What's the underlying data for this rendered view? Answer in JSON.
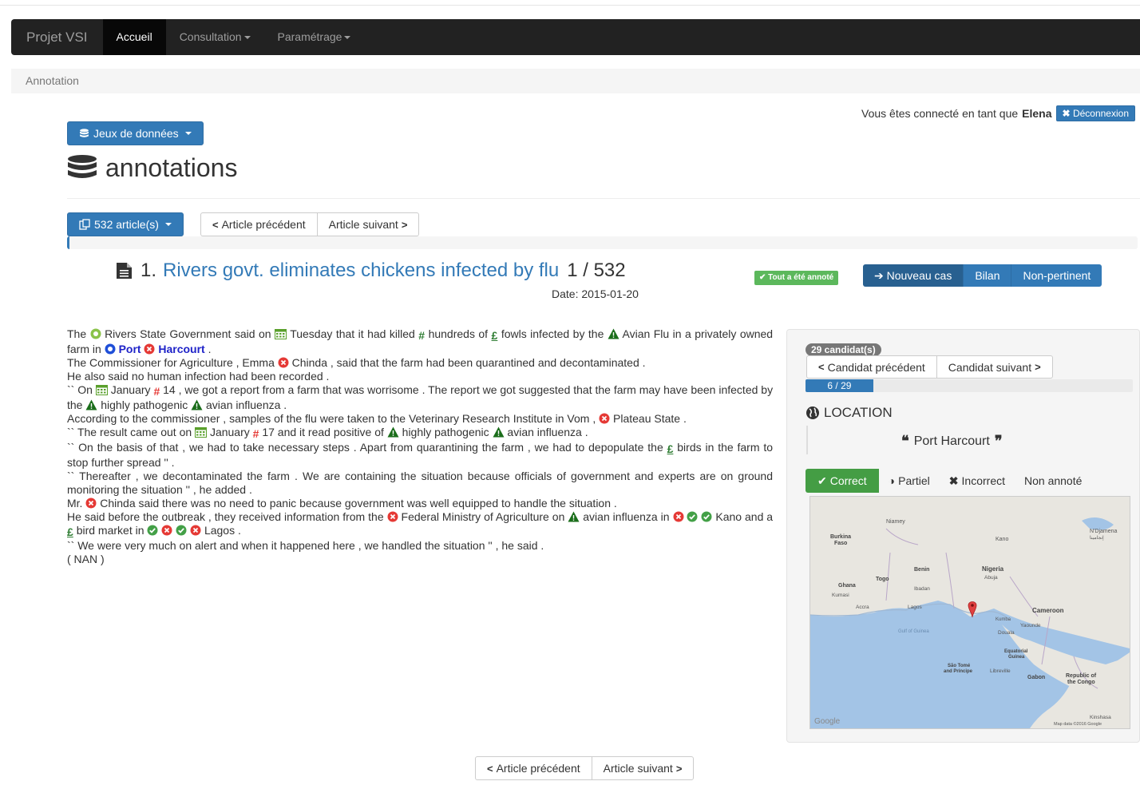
{
  "navbar": {
    "brand": "Projet VSI",
    "items": [
      {
        "label": "Accueil",
        "active": true,
        "dropdown": false
      },
      {
        "label": "Consultation",
        "active": false,
        "dropdown": true
      },
      {
        "label": "Paramétrage",
        "active": false,
        "dropdown": true
      }
    ]
  },
  "breadcrumb": "Annotation",
  "user": {
    "prefix": "Vous êtes connecté en tant que",
    "name": "Elena",
    "logout_label": "Déconnexion"
  },
  "datasets_button": "Jeux de données",
  "page_title": "annotations",
  "articles_button": "532 article(s)",
  "article_nav": {
    "prev": "Article précédent",
    "next": "Article suivant"
  },
  "article": {
    "index": "1.",
    "title": "Rivers govt. eliminates chickens infected by flu",
    "position": "1 / 532",
    "date": "Date: 2015-01-20",
    "done_badge": "Tout a été annoté",
    "progress_fraction": 0.002
  },
  "actions": {
    "new_case": "Nouveau cas",
    "summary": "Bilan",
    "not_relevant": "Non-pertinent"
  },
  "body": {
    "l1a": "The",
    "l1b": "Rivers State Government said on",
    "l1c": "Tuesday that it had killed",
    "l1d": "hundreds of",
    "l1e": "fowls infected by the",
    "l1f": "Avian Flu in a privately owned farm in",
    "l1g": "Port",
    "l1h": "Harcourt",
    "l1i": ".",
    "l2a": "The Commissioner for Agriculture , Emma",
    "l2b": "Chinda , said that the farm had been quarantined and decontaminated .",
    "l3": "He also said no human infection had been recorded .",
    "l4a": "`` On",
    "l4b": "January",
    "l4c": "14 , we got a report from a farm that was worrisome . The report we got suggested that the farm may have been infected by the",
    "l4d": "highly pathogenic",
    "l4e": "avian influenza .",
    "l5a": "According to the commissioner , samples of the flu were taken to the Veterinary Research Institute in Vom ,",
    "l5b": "Plateau State .",
    "l6a": "`` The result came out on",
    "l6b": "January",
    "l6c": "17 and it read positive of",
    "l6d": "highly pathogenic",
    "l6e": "avian influenza .",
    "l7a": "`` On the basis of that , we had to take necessary steps . Apart from quarantining the farm , we had to depopulate the",
    "l7b": "birds in the farm to stop further spread '' .",
    "l8": "`` Thereafter , we decontaminated the farm . We are containing the situation because officials of government and experts are on ground monitoring the situation '' , he added .",
    "l9a": "Mr.",
    "l9b": "Chinda said there was no need to panic because government was well equipped to handle the situation .",
    "l10a": "He said before the outbreak , they received information from the",
    "l10b": "Federal Ministry of Agriculture on",
    "l10c": "avian influenza in",
    "l10d": "Kano and a",
    "l10e": "bird market in",
    "l10f": "Lagos .",
    "l11": "`` We were very much on alert and when it happened here , we handled the situation '' , he said .",
    "l12": "( NAN )"
  },
  "candidates": {
    "count_badge": "29 candidat(s)",
    "prev": "Candidat précédent",
    "next": "Candidat suivant",
    "progress_label": "6 / 29",
    "progress_fraction": 0.207,
    "section_title": "LOCATION",
    "location": "Port Harcourt"
  },
  "judgement": {
    "correct": "Correct",
    "partial": "Partiel",
    "incorrect": "Incorrect",
    "not_annotated": "Non annoté"
  },
  "map": {
    "labels": {
      "niamey": "Niamey",
      "ndjamena": "N'Djamena",
      "ndjamena_ar": "إنجامينا",
      "burkina": "Burkina",
      "faso": "Faso",
      "kano": "Kano",
      "benin": "Benin",
      "nigeria": "Nigeria",
      "abuja": "Abuja",
      "ghana": "Ghana",
      "togo": "Togo",
      "kumasi": "Kumasi",
      "ibadan": "Ibadan",
      "accra": "Accra",
      "lagos": "Lagos",
      "cameroon": "Cameroon",
      "kumba": "Kumba",
      "yaounde": "Yaounde",
      "douala": "Douala",
      "gulf": "Gulf of Guinea",
      "eq1": "Equatorial",
      "eq2": "Guinea",
      "stp1": "São Tomé",
      "stp2": "and Príncipe",
      "libreville": "Libreville",
      "gabon": "Gabon",
      "roc1": "Republic of",
      "roc2": "the Congo",
      "kinshasa": "Kinshasa",
      "google": "Google",
      "mapdata": "Map data ©2016 Google"
    },
    "colors": {
      "land": "#e8e6e0",
      "water": "#a3c4e6",
      "marker": "#e04040"
    }
  },
  "colors": {
    "primary": "#337ab7",
    "success": "#5cb85c",
    "navbar": "#222222"
  }
}
